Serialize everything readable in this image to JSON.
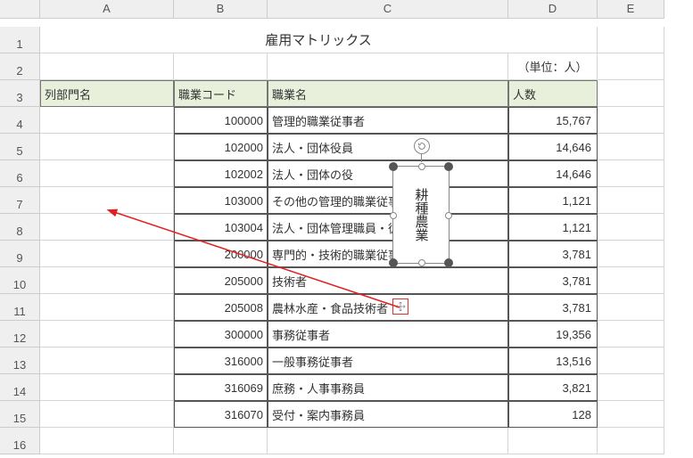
{
  "colHeaders": [
    "A",
    "B",
    "C",
    "D",
    "E"
  ],
  "rowHeaders": [
    "1",
    "2",
    "3",
    "4",
    "5",
    "6",
    "7",
    "8",
    "9",
    "10",
    "11",
    "12",
    "13",
    "14",
    "15",
    "16"
  ],
  "title": "雇用マトリックス",
  "unit": "（単位：人）",
  "headers": {
    "colA": "列部門名",
    "colB": "職業コード",
    "colC": "職業名",
    "colD": "人数"
  },
  "rows": [
    {
      "code": "100000",
      "name": "管理的職業従事者",
      "count": "15,767"
    },
    {
      "code": "102000",
      "name": "法人・団体役員",
      "count": "14,646"
    },
    {
      "code": "102002",
      "name": "法人・団体の役",
      "count": "14,646"
    },
    {
      "code": "103000",
      "name": "その他の管理的職業従事者",
      "count": "1,121"
    },
    {
      "code": "103004",
      "name": "法人・団体管理職員・従事者",
      "count": "1,121"
    },
    {
      "code": "200000",
      "name": "専門的・技術的職業従事者",
      "count": "3,781"
    },
    {
      "code": "205000",
      "name": "技術者",
      "count": "3,781"
    },
    {
      "code": "205008",
      "name": "農林水産・食品技術者",
      "count": "3,781"
    },
    {
      "code": "300000",
      "name": "事務従事者",
      "count": "19,356"
    },
    {
      "code": "316000",
      "name": "一般事務従事者",
      "count": "13,516"
    },
    {
      "code": "316069",
      "name": "庶務・人事事務員",
      "count": "3,821"
    },
    {
      "code": "316070",
      "name": "受付・案内事務員",
      "count": "128"
    }
  ],
  "floatingText": "耕種農業"
}
